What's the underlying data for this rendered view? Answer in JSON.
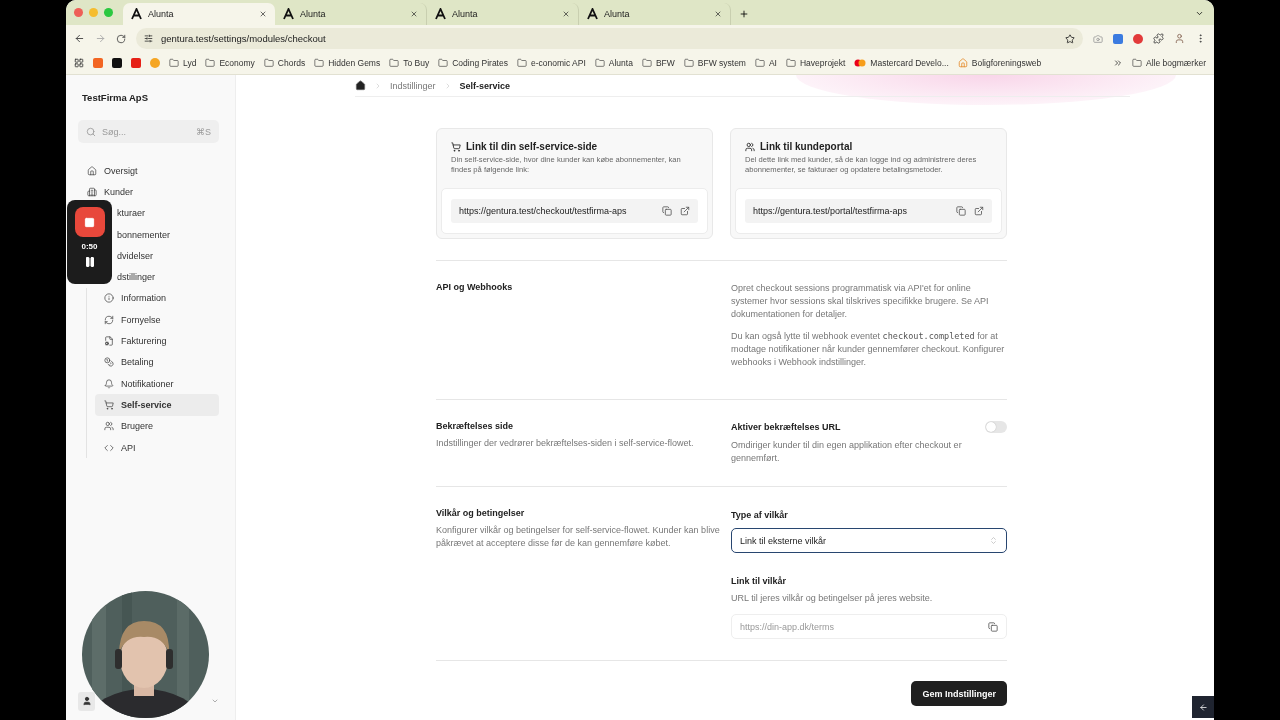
{
  "browser": {
    "tabs": [
      {
        "title": "Alunta",
        "selected": true
      },
      {
        "title": "Alunta",
        "selected": false
      },
      {
        "title": "Alunta",
        "selected": false
      },
      {
        "title": "Alunta",
        "selected": false
      }
    ],
    "url": "gentura.test/settings/modules/checkout",
    "bookmarks": [
      {
        "label": "Lyd",
        "kind": "folder"
      },
      {
        "label": "Economy",
        "kind": "folder"
      },
      {
        "label": "Chords",
        "kind": "folder"
      },
      {
        "label": "Hidden Gems",
        "kind": "folder"
      },
      {
        "label": "To Buy",
        "kind": "folder"
      },
      {
        "label": "Coding Pirates",
        "kind": "folder"
      },
      {
        "label": "e-conomic API",
        "kind": "folder"
      },
      {
        "label": "Alunta",
        "kind": "folder"
      },
      {
        "label": "BFW",
        "kind": "folder"
      },
      {
        "label": "BFW system",
        "kind": "folder"
      },
      {
        "label": "AI",
        "kind": "folder"
      },
      {
        "label": "Haveprojekt",
        "kind": "folder"
      },
      {
        "label": "Mastercard Develo...",
        "kind": "card"
      },
      {
        "label": "Boligforeningsweb",
        "kind": "house"
      }
    ],
    "all_bookmarks": "Alle bogmærker"
  },
  "recording": {
    "time": "0:50"
  },
  "sidebar": {
    "company": "TestFirma ApS",
    "search": {
      "placeholder": "Søg...",
      "shortcut": "⌘S"
    },
    "items": [
      {
        "label": "Oversigt",
        "selected": false,
        "covered": false
      },
      {
        "label": "Kunder",
        "selected": false,
        "covered": false
      },
      {
        "label": "kturaer",
        "selected": false,
        "covered": true
      },
      {
        "label": "bonnementer",
        "selected": false,
        "covered": true
      },
      {
        "label": "dvidelser",
        "selected": false,
        "covered": true
      },
      {
        "label": "dstillinger",
        "selected": false,
        "covered": true,
        "children": [
          {
            "label": "Information",
            "selected": false
          },
          {
            "label": "Fornyelse",
            "selected": false
          },
          {
            "label": "Fakturering",
            "selected": false
          },
          {
            "label": "Betaling",
            "selected": false
          },
          {
            "label": "Notifikationer",
            "selected": false
          },
          {
            "label": "Self-service",
            "selected": true
          },
          {
            "label": "Brugere",
            "selected": false
          },
          {
            "label": "API",
            "selected": false
          }
        ]
      }
    ]
  },
  "breadcrumb": [
    "Indstillinger",
    "Self-service"
  ],
  "link_cards": [
    {
      "title": "Link til din self-service-side",
      "description": "Din self-service-side, hvor dine kunder kan købe abonnementer, kan findes på følgende link:",
      "url": "https://gentura.test/checkout/testfirma-aps"
    },
    {
      "title": "Link til kundeportal",
      "description": "Del dette link med kunder, så de kan logge ind og administrere deres abonnementer, se fakturaer og opdatere betalingsmetoder.",
      "url": "https://gentura.test/portal/testfirma-aps"
    }
  ],
  "sections": [
    {
      "kind": "info",
      "title": "API og Webhooks",
      "paragraphs": [
        {
          "before": "Opret checkout sessions programmatisk via API'et for online systemer hvor sessions skal tilskrives specifikke brugere. Se API dokumentationen for detaljer."
        },
        {
          "before": "Du kan også lytte til webhook eventet",
          "code": "checkout.completed",
          "after": "for at modtage notifikationer når kunder gennemfører checkout. Konfigurer webhooks i Webhook indstillinger."
        }
      ]
    },
    {
      "kind": "toggle",
      "title": "Bekræftelses side",
      "description": "Indstillinger der vedrører bekræftelses-siden i self-service-flowet.",
      "setting": {
        "label": "Aktiver bekræftelses URL",
        "description": "Omdiriger kunder til din egen applikation efter checkout er gennemført.",
        "on": false
      }
    },
    {
      "kind": "terms",
      "title": "Vilkår og betingelser",
      "description": "Konfigurer vilkår og betingelser for self-service-flowet. Kunder kan blive påkrævet at acceptere disse før de kan gennemføre købet.",
      "select": {
        "label": "Type af vilkår",
        "value": "Link til eksterne vilkår"
      },
      "link_field": {
        "label": "Link til vilkår",
        "description": "URL til jeres vilkår og betingelser på jeres website.",
        "placeholder": "https://din-app.dk/terms"
      }
    }
  ],
  "save_button": "Gem Indstillinger"
}
